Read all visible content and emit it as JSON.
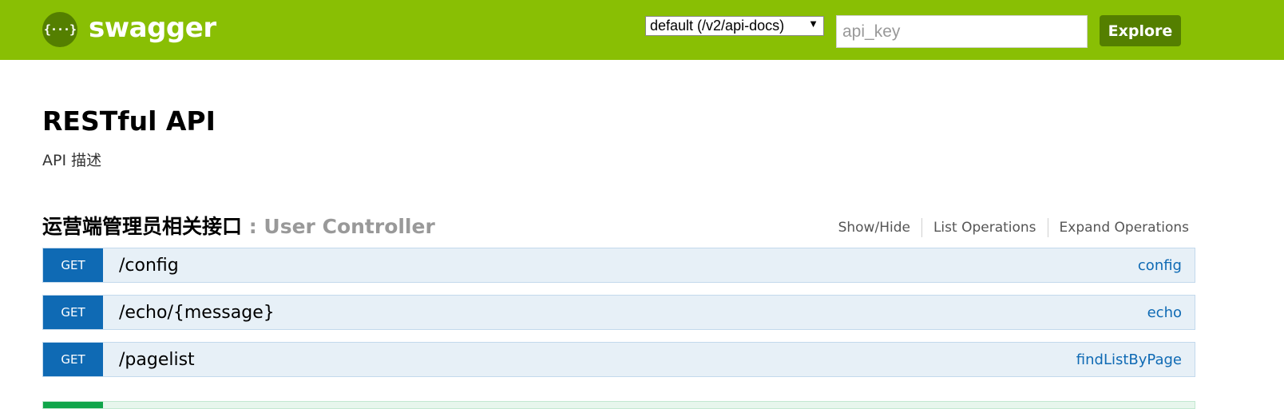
{
  "header": {
    "logo_glyph": "{···}",
    "brand": "swagger",
    "spec_select": "default (/v2/api-docs)",
    "api_key_placeholder": "api_key",
    "explore_label": "Explore",
    "colors": {
      "bar": "#89bf04",
      "button": "#547f00"
    }
  },
  "info": {
    "title": "RESTful API",
    "description": "API 描述"
  },
  "resource": {
    "name": "运营端管理员相关接口",
    "separator": " : ",
    "controller": "User Controller",
    "options": {
      "show_hide": "Show/Hide",
      "list_operations": "List Operations",
      "expand_operations": "Expand Operations"
    },
    "operations": [
      {
        "method": "GET",
        "path": "/config",
        "name": "config"
      },
      {
        "method": "GET",
        "path": "/echo/{message}",
        "name": "echo"
      },
      {
        "method": "GET",
        "path": "/pagelist",
        "name": "findListByPage"
      }
    ]
  }
}
